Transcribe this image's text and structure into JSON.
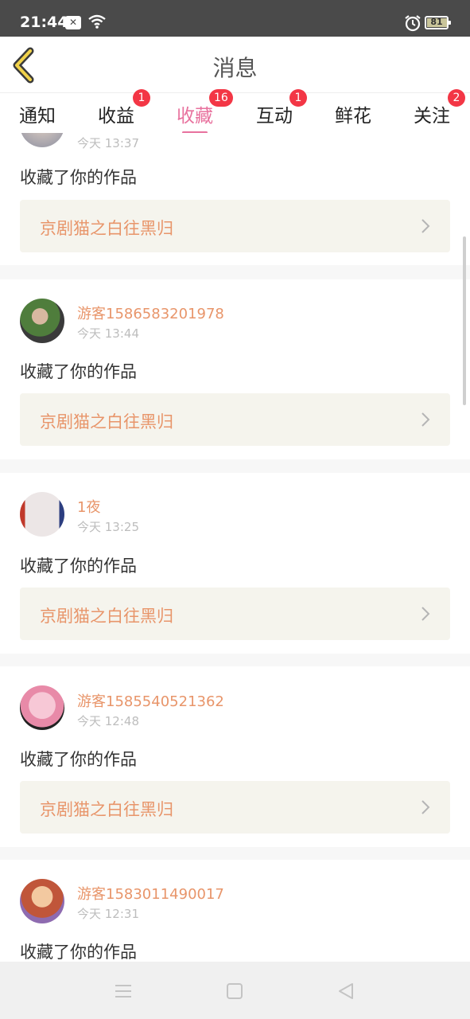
{
  "status": {
    "time": "21:44",
    "battery": "81",
    "notif_icon": "x-notification-icon"
  },
  "header": {
    "title": "消息"
  },
  "tabs": [
    {
      "label": "通知",
      "badge": ""
    },
    {
      "label": "收益",
      "badge": "1"
    },
    {
      "label": "收藏",
      "badge": "16",
      "active": true
    },
    {
      "label": "互动",
      "badge": "1"
    },
    {
      "label": "鲜花",
      "badge": ""
    },
    {
      "label": "关注",
      "badge": "2"
    }
  ],
  "items": [
    {
      "user": "",
      "time": "今天 13:37",
      "action": "收藏了你的作品",
      "work": "京剧猫之白往黑归"
    },
    {
      "user": "游客1586583201978",
      "time": "今天 13:44",
      "action": "收藏了你的作品",
      "work": "京剧猫之白往黑归"
    },
    {
      "user": "1夜",
      "time": "今天 13:25",
      "action": "收藏了你的作品",
      "work": "京剧猫之白往黑归"
    },
    {
      "user": "游客1585540521362",
      "time": "今天 12:48",
      "action": "收藏了你的作品",
      "work": "京剧猫之白往黑归"
    },
    {
      "user": "游客1583011490017",
      "time": "今天 12:31",
      "action": "收藏了你的作品",
      "work": ""
    }
  ],
  "colors": {
    "accent": "#e8729e",
    "name": "#e8956a",
    "badge": "#f33645",
    "work_bg": "#f5f4ed"
  }
}
